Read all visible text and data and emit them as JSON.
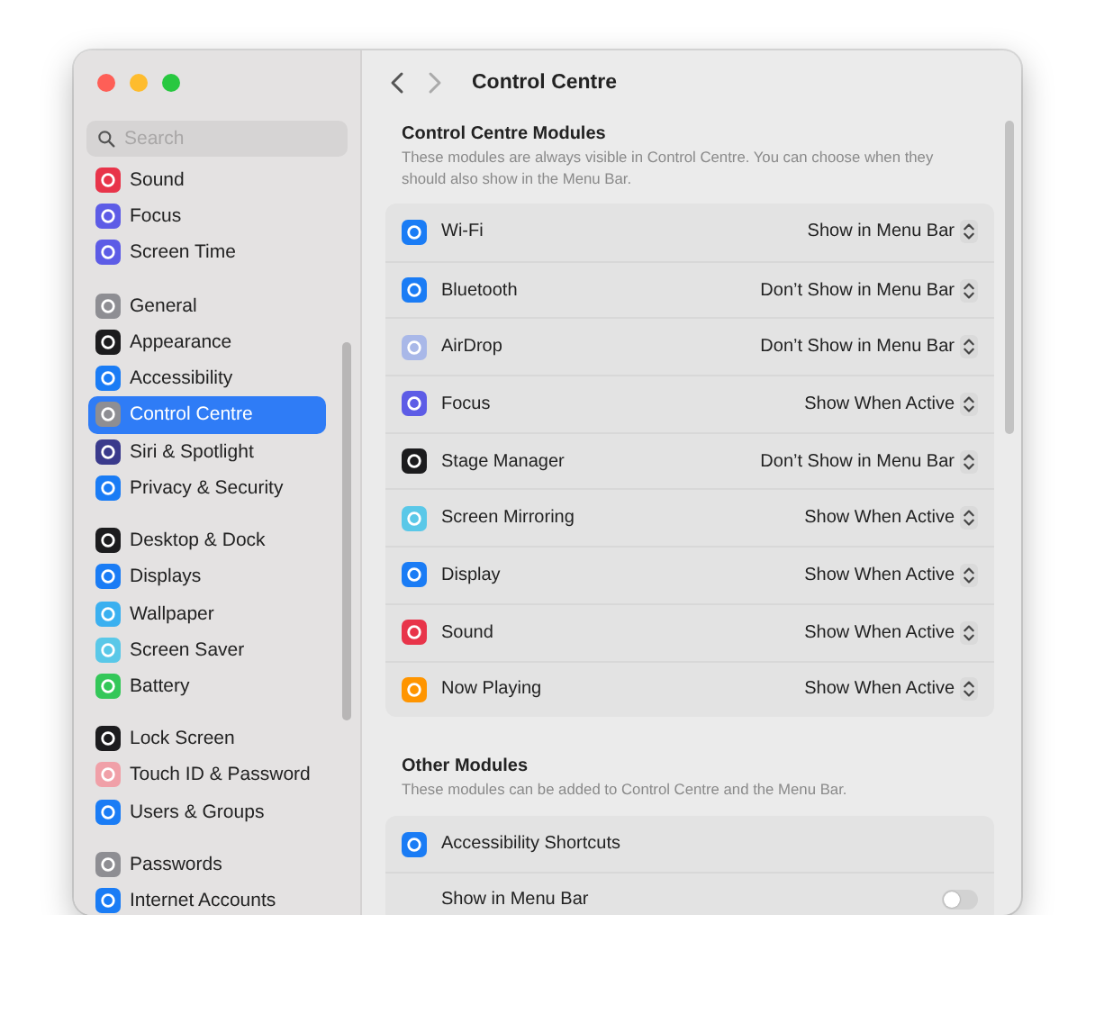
{
  "window": {
    "title": "Control Centre"
  },
  "sidebar": {
    "search": {
      "placeholder": "Search"
    },
    "groups": [
      {
        "items": [
          {
            "label": "Sound",
            "color": "#e8344a",
            "selected": false
          },
          {
            "label": "Focus",
            "color": "#5d5ce6",
            "selected": false
          },
          {
            "label": "Screen Time",
            "color": "#5d5ce6",
            "selected": false
          }
        ]
      },
      {
        "items": [
          {
            "label": "General",
            "color": "#8e8e93",
            "selected": false
          },
          {
            "label": "Appearance",
            "color": "#1c1c1e",
            "selected": false
          },
          {
            "label": "Accessibility",
            "color": "#1a7cf5",
            "selected": false
          },
          {
            "label": "Control Centre",
            "color": "#8e8e93",
            "selected": true
          },
          {
            "label": "Siri & Spotlight",
            "color": "#3a3a8c",
            "selected": false
          },
          {
            "label": "Privacy & Security",
            "color": "#1a7cf5",
            "selected": false
          }
        ]
      },
      {
        "items": [
          {
            "label": "Desktop & Dock",
            "color": "#1c1c1e",
            "selected": false
          },
          {
            "label": "Displays",
            "color": "#1a7cf5",
            "selected": false
          },
          {
            "label": "Wallpaper",
            "color": "#3bb0f0",
            "selected": false
          },
          {
            "label": "Screen Saver",
            "color": "#5ac8e8",
            "selected": false
          },
          {
            "label": "Battery",
            "color": "#34c759",
            "selected": false
          }
        ]
      },
      {
        "items": [
          {
            "label": "Lock Screen",
            "color": "#1c1c1e",
            "selected": false
          },
          {
            "label": "Touch ID & Password",
            "color": "#f0a0a8",
            "selected": false
          },
          {
            "label": "Users & Groups",
            "color": "#1a7cf5",
            "selected": false
          }
        ]
      },
      {
        "items": [
          {
            "label": "Passwords",
            "color": "#8e8e93",
            "selected": false
          },
          {
            "label": "Internet Accounts",
            "color": "#1a7cf5",
            "selected": false
          }
        ]
      }
    ]
  },
  "control_centre_modules": {
    "title": "Control Centre Modules",
    "description": "These modules are always visible in Control Centre. You can choose when they should also show in the Menu Bar.",
    "modules": [
      {
        "label": "Wi-Fi",
        "color": "#1a7cf5",
        "value": "Show in Menu Bar"
      },
      {
        "label": "Bluetooth",
        "color": "#1a7cf5",
        "value": "Don’t Show in Menu Bar"
      },
      {
        "label": "AirDrop",
        "color": "#a9b8e8",
        "value": "Don’t Show in Menu Bar"
      },
      {
        "label": "Focus",
        "color": "#5d5ce6",
        "value": "Show When Active"
      },
      {
        "label": "Stage Manager",
        "color": "#1c1c1e",
        "value": "Don’t Show in Menu Bar"
      },
      {
        "label": "Screen Mirroring",
        "color": "#5ac8e8",
        "value": "Show When Active"
      },
      {
        "label": "Display",
        "color": "#1a7cf5",
        "value": "Show When Active"
      },
      {
        "label": "Sound",
        "color": "#e8344a",
        "value": "Show When Active"
      },
      {
        "label": "Now Playing",
        "color": "#ff9500",
        "value": "Show When Active"
      }
    ]
  },
  "other_modules": {
    "title": "Other Modules",
    "description": "These modules can be added to Control Centre and the Menu Bar.",
    "modules": [
      {
        "label": "Accessibility Shortcuts",
        "color": "#1a7cf5",
        "option": {
          "label": "Show in Menu Bar",
          "on": false
        }
      }
    ]
  }
}
